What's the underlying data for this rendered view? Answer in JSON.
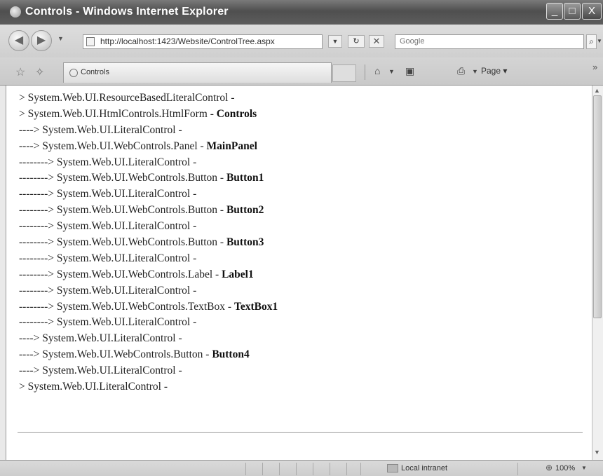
{
  "window": {
    "title": "Controls - Windows Internet Explorer",
    "minimize_glyph": "_",
    "maximize_glyph": "□",
    "close_glyph": "X"
  },
  "navigation": {
    "back_glyph": "◀",
    "forward_glyph": "▶",
    "url": "http://localhost:1423/Website/ControlTree.aspx",
    "search_placeholder": "Google"
  },
  "tab": {
    "label": "Controls"
  },
  "toolbar": {
    "page_label": "Page ▾",
    "chevron": "»"
  },
  "content": {
    "lines": [
      {
        "prefix": "> ",
        "type": "System.Web.UI.ResourceBasedLiteralControl -",
        "id": ""
      },
      {
        "prefix": "> ",
        "type": "System.Web.UI.HtmlControls.HtmlForm - ",
        "id": "Controls"
      },
      {
        "prefix": "----> ",
        "type": "System.Web.UI.LiteralControl -",
        "id": ""
      },
      {
        "prefix": "----> ",
        "type": "System.Web.UI.WebControls.Panel - ",
        "id": "MainPanel"
      },
      {
        "prefix": "--------> ",
        "type": "System.Web.UI.LiteralControl -",
        "id": ""
      },
      {
        "prefix": "--------> ",
        "type": "System.Web.UI.WebControls.Button - ",
        "id": "Button1"
      },
      {
        "prefix": "--------> ",
        "type": "System.Web.UI.LiteralControl -",
        "id": ""
      },
      {
        "prefix": "--------> ",
        "type": "System.Web.UI.WebControls.Button - ",
        "id": "Button2"
      },
      {
        "prefix": "--------> ",
        "type": "System.Web.UI.LiteralControl -",
        "id": ""
      },
      {
        "prefix": "--------> ",
        "type": "System.Web.UI.WebControls.Button - ",
        "id": "Button3"
      },
      {
        "prefix": "--------> ",
        "type": "System.Web.UI.LiteralControl -",
        "id": ""
      },
      {
        "prefix": "--------> ",
        "type": "System.Web.UI.WebControls.Label - ",
        "id": "Label1"
      },
      {
        "prefix": "--------> ",
        "type": "System.Web.UI.LiteralControl -",
        "id": ""
      },
      {
        "prefix": "--------> ",
        "type": "System.Web.UI.WebControls.TextBox - ",
        "id": "TextBox1"
      },
      {
        "prefix": "--------> ",
        "type": "System.Web.UI.LiteralControl -",
        "id": ""
      },
      {
        "prefix": "----> ",
        "type": "System.Web.UI.LiteralControl -",
        "id": ""
      },
      {
        "prefix": "----> ",
        "type": "System.Web.UI.WebControls.Button - ",
        "id": "Button4"
      },
      {
        "prefix": "----> ",
        "type": "System.Web.UI.LiteralControl -",
        "id": ""
      },
      {
        "prefix": "> ",
        "type": "System.Web.UI.LiteralControl -",
        "id": ""
      }
    ]
  },
  "statusbar": {
    "zone": "Local intranet",
    "zoom": "100%"
  },
  "icons": {
    "favorites": "star-icon",
    "add_favorites": "add-favorites-icon",
    "home": "home-icon",
    "feeds": "feeds-icon",
    "print": "print-icon",
    "page": "page-icon",
    "search": "search-icon"
  }
}
